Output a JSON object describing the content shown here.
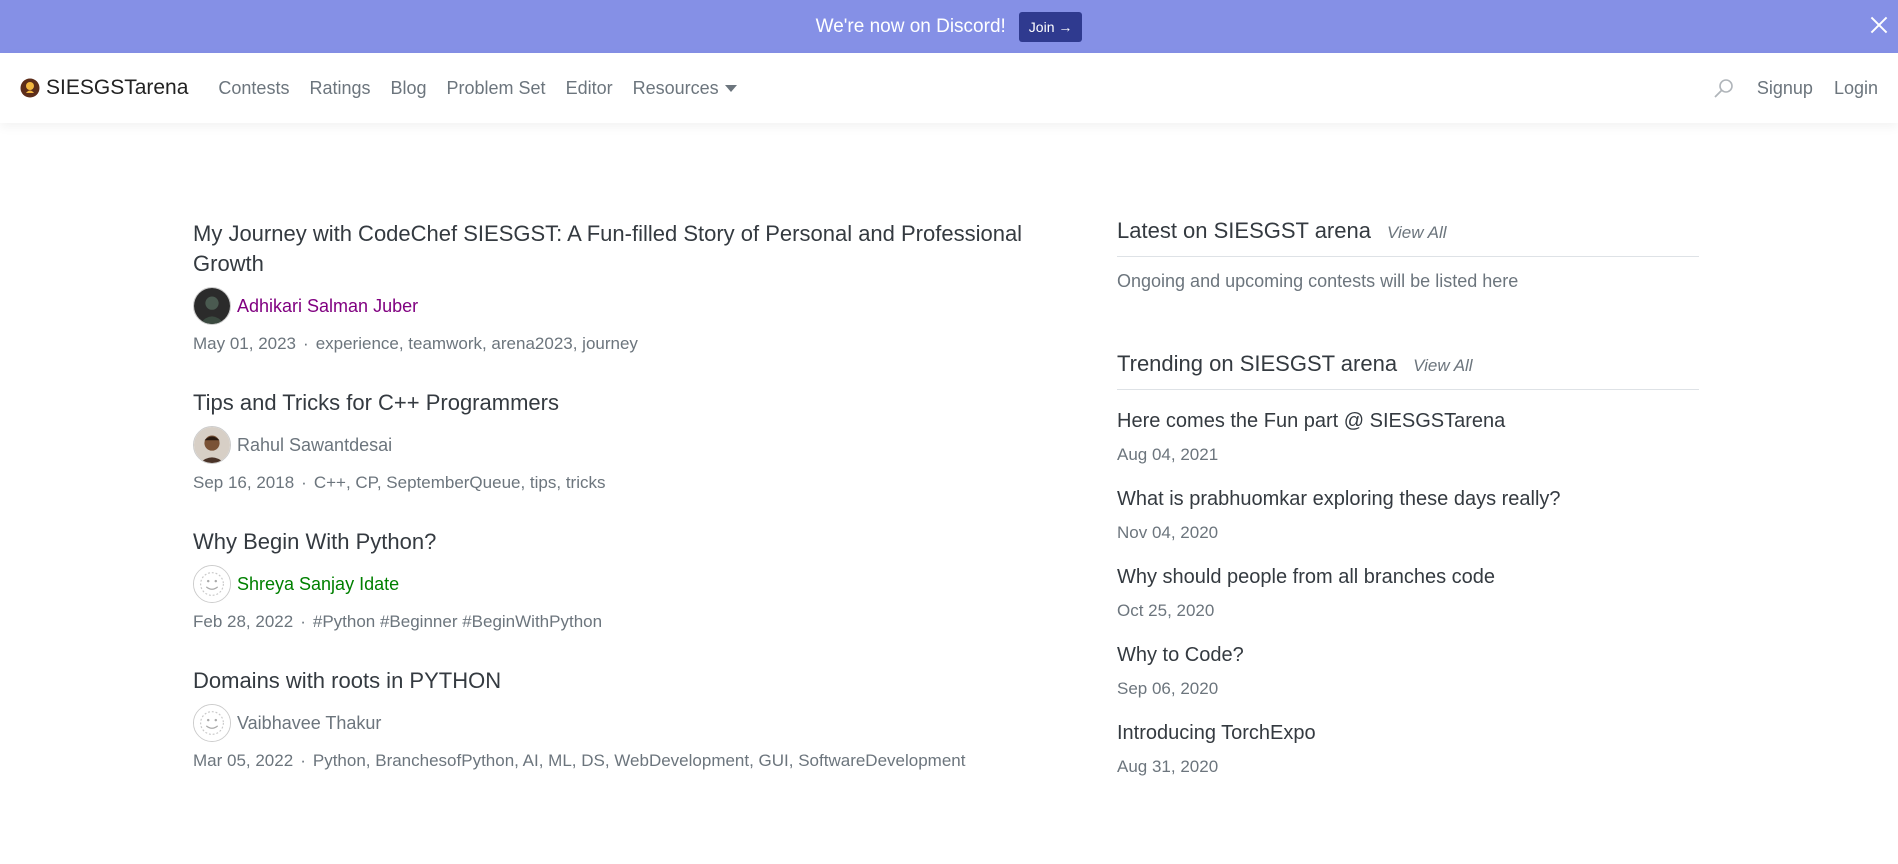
{
  "banner": {
    "text": "We're now on Discord!",
    "join_label": "Join →"
  },
  "navbar": {
    "brand": "SIESGSTarena",
    "links": [
      "Contests",
      "Ratings",
      "Blog",
      "Problem Set",
      "Editor",
      "Resources"
    ],
    "signup": "Signup",
    "login": "Login"
  },
  "posts": [
    {
      "title": "My Journey with CodeChef SIESGST: A Fun-filled Story of Personal and Professional Growth",
      "author": "Adhikari Salman Juber",
      "author_color": "#800080",
      "date": "May 01, 2023",
      "tags": "experience, teamwork, arena2023, journey"
    },
    {
      "title": "Tips and Tricks for C++ Programmers",
      "author": "Rahul Sawantdesai",
      "author_color": "#6c757d",
      "date": "Sep 16, 2018",
      "tags": "C++, CP, SeptemberQueue, tips, tricks"
    },
    {
      "title": "Why Begin With Python?",
      "author": "Shreya Sanjay Idate",
      "author_color": "#008000",
      "date": "Feb 28, 2022",
      "tags": "#Python #Beginner #BeginWithPython"
    },
    {
      "title": "Domains with roots in PYTHON",
      "author": "Vaibhavee Thakur",
      "author_color": "#6c757d",
      "date": "Mar 05, 2022",
      "tags": "Python, BranchesofPython, AI, ML, DS, WebDevelopment, GUI, SoftwareDevelopment"
    }
  ],
  "sidebar": {
    "latest": {
      "title": "Latest on SIESGST arena",
      "view_all": "View All",
      "note": "Ongoing and upcoming contests will be listed here"
    },
    "trending": {
      "title": "Trending on SIESGST arena",
      "view_all": "View All",
      "items": [
        {
          "title": "Here comes the Fun part @ SIESGSTarena",
          "date": "Aug 04, 2021"
        },
        {
          "title": "What is prabhuomkar exploring these days really?",
          "date": "Nov 04, 2020"
        },
        {
          "title": "Why should people from all branches code",
          "date": "Oct 25, 2020"
        },
        {
          "title": "Why to Code?",
          "date": "Sep 06, 2020"
        },
        {
          "title": "Introducing TorchExpo",
          "date": "Aug 31, 2020"
        }
      ]
    }
  }
}
